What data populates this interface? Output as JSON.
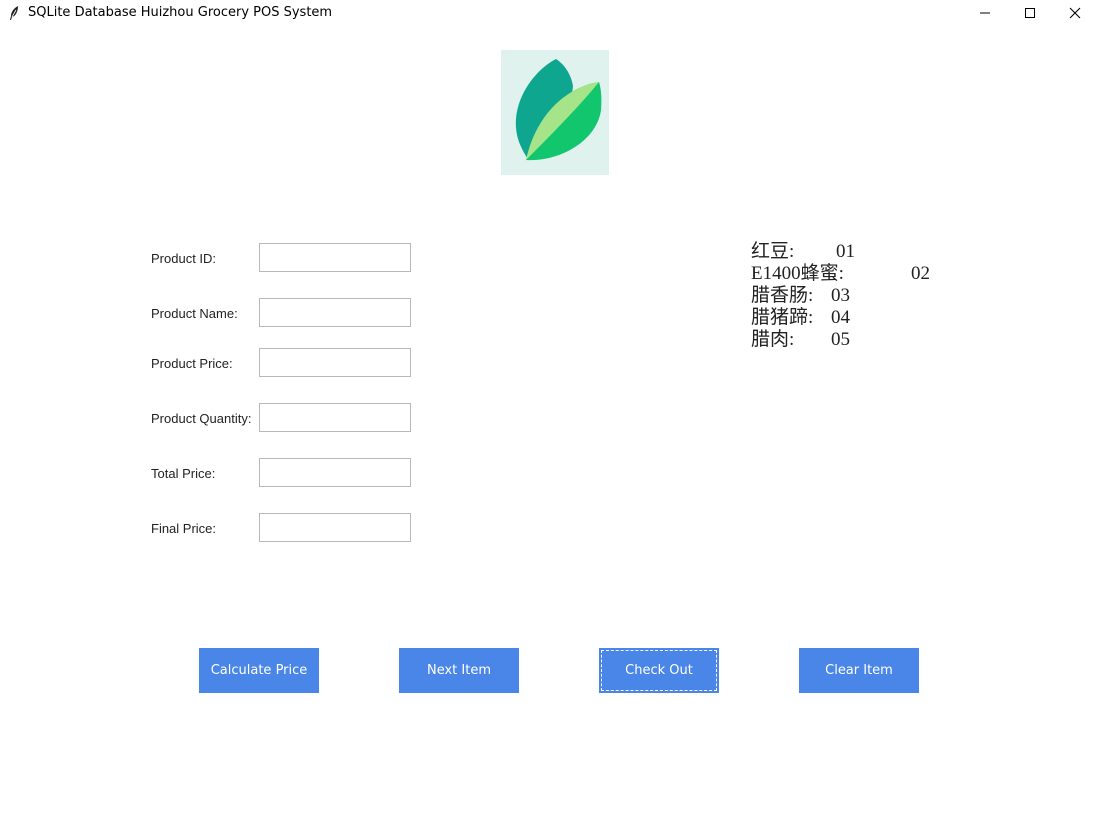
{
  "window": {
    "title": "SQLite Database Huizhou Grocery POS System"
  },
  "form": {
    "fields": [
      {
        "label": "Product ID:",
        "value": ""
      },
      {
        "label": "Product Name:",
        "value": ""
      },
      {
        "label": "Product Price:",
        "value": ""
      },
      {
        "label": "Product Quantity:",
        "value": ""
      },
      {
        "label": "Total Price:",
        "value": ""
      },
      {
        "label": "Final Price:",
        "value": ""
      }
    ]
  },
  "products": [
    {
      "name": "红豆:",
      "code": "01"
    },
    {
      "name": "E1400蜂蜜:",
      "code": "02"
    },
    {
      "name": "腊香肠:",
      "code": "03"
    },
    {
      "name": "腊猪蹄:",
      "code": "04"
    },
    {
      "name": "腊肉:",
      "code": "05"
    }
  ],
  "buttons": {
    "calculate": "Calculate Price",
    "next": "Next Item",
    "checkout": "Check Out",
    "clear": "Clear Item"
  },
  "colors": {
    "button_bg": "#4a86e8",
    "logo_bg": "#dff2ee",
    "leaf_dark": "#0fa68f",
    "leaf_light": "#a6e48a",
    "leaf_mid": "#12c66e"
  },
  "icons": {
    "app": "feather-icon",
    "minimize": "minimize-icon",
    "maximize": "maximize-icon",
    "close": "close-icon",
    "logo": "leaf-logo"
  }
}
